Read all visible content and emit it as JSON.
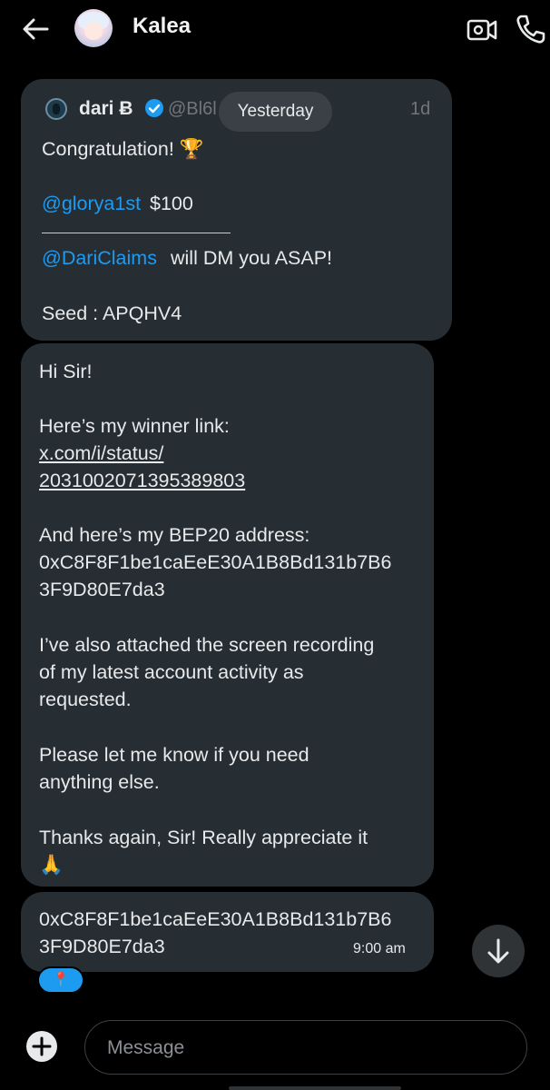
{
  "header": {
    "contact_name": "Kalea",
    "icons": [
      "back-arrow-icon",
      "video-camera-icon",
      "phone-icon"
    ]
  },
  "quote": {
    "name": "dari Ƀ",
    "handle": "@Bl6l",
    "time": "1d",
    "lines": [
      "Congratulation! 🏆",
      "@glorya1st",
      "$100",
      "@DariClaims",
      "will DM you ASAP!",
      "Seed : APQHV4"
    ]
  },
  "date_divider": "Yesterday",
  "message": {
    "greeting": "Hi Sir!",
    "link_intro": "Here’s my winner link:",
    "link_line1": "x.com/i/status/",
    "link_line2": "2031002071395389803",
    "address_intro": "And here’s my BEP20 address:",
    "address_line1": "0xC8F8F1be1caEeE30A1B8Bd131b7B6",
    "address_line2": "3F9D80E7da3",
    "recording_line1": "I’ve also attached the screen recording",
    "recording_line2": "of my latest account activity as",
    "recording_line3": "requested.",
    "help_line1": "Please let me know if you need",
    "help_line2": "anything else.",
    "thanks_line1": "Thanks again, Sir! Really appreciate it",
    "thanks_line2": "🙏"
  },
  "last_message": {
    "line1": "0xC8F8F1be1caEeE30A1B8Bd131b7B6",
    "line2": "3F9D80E7da3",
    "time": "9:00 am",
    "reaction": "📍"
  },
  "composer": {
    "placeholder": "Message"
  },
  "colors": {
    "background": "#000000",
    "bubble": "#262d33",
    "accent": "#1d9bf0",
    "muted_text": "#71767b"
  }
}
